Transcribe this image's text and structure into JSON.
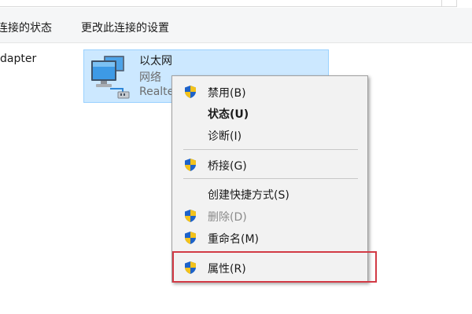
{
  "commandbar": {
    "status_label": "连接的状态",
    "settings_label": "更改此连接的设置"
  },
  "content": {
    "left_adapter_label": "dapter",
    "adapter": {
      "name": "以太网",
      "line2": "网络",
      "line3": "Realte"
    }
  },
  "context_menu": {
    "items": [
      {
        "label": "禁用(B)",
        "icon": "shield-icon"
      },
      {
        "label": "状态(U)"
      },
      {
        "label": "诊断(I)"
      },
      {
        "label": "桥接(G)",
        "icon": "shield-icon"
      },
      {
        "label": "创建快捷方式(S)"
      },
      {
        "label": "删除(D)",
        "icon": "shield-icon",
        "disabled": true
      },
      {
        "label": "重命名(M)",
        "icon": "shield-icon"
      },
      {
        "label": "属性(R)",
        "icon": "shield-icon"
      }
    ]
  },
  "colors": {
    "selection_fill": "#cce8ff",
    "selection_border": "#99d1ff",
    "highlight_red": "#d23a45",
    "shield_blue": "#1e63c9",
    "shield_yellow": "#f3c21b"
  }
}
